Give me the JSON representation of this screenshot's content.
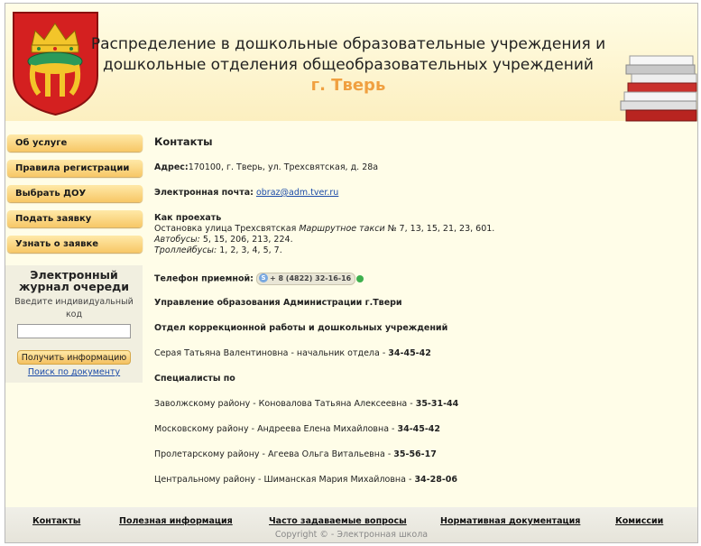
{
  "header": {
    "title_line1": "Распределение в дошкольные образовательные учреждения и",
    "title_line2": "дошкольные отделения общеобразовательных учреждений",
    "city": "г. Тверь"
  },
  "nav": [
    {
      "label": "Об услуге"
    },
    {
      "label": "Правила регистрации"
    },
    {
      "label": "Выбрать ДОУ"
    },
    {
      "label": "Подать заявку"
    },
    {
      "label": "Узнать о заявке"
    }
  ],
  "journal": {
    "title": "Электронный журнал очереди",
    "hint": "Введите индивидуальный код",
    "input_value": "",
    "button_label": "Получить информацию",
    "link_label": "Поиск по документу"
  },
  "content": {
    "heading": "Контакты",
    "address_label": "Адрес:",
    "address_value": "170100, г. Тверь, ул. Трехсвятская, д. 28а",
    "email_label": "Электронная почта:",
    "email_value": "obraz@adm.tver.ru",
    "howto_label": "Как проехать",
    "howto_stop": "Остановка улица Трехсвятская ",
    "howto_taxi_label": "Маршрутное такси",
    "howto_taxi_value": " № 7, 13, 15, 21, 23, 601.",
    "howto_bus_label": "Автобусы:",
    "howto_bus_value": " 5, 15, 206, 213, 224.",
    "howto_trolley_label": "Троллейбусы:",
    "howto_trolley_value": " 1, 2, 3, 4, 5, 7.",
    "phone_label": "Телефон приемной:",
    "phone_value": "+ 8 (4822) 32-16-16",
    "org": "Управление образования Администрации г.Твери",
    "dept": "Отдел коррекционной работы и дошкольных учреждений",
    "head_text": "Серая Татьяна Валентиновна - начальник отдела - ",
    "head_phone": "34-45-42",
    "specialists_label": "Специалисты по",
    "specialists": [
      {
        "text": "Заволжскому району - Коновалова Татьяна Алексеевна - ",
        "phone": "35-31-44"
      },
      {
        "text": "Московскому району - Андреева Елена Михайловна - ",
        "phone": "34-45-42"
      },
      {
        "text": "Пролетарскому району - Агеева Ольга Витальевна - ",
        "phone": "35-56-17"
      },
      {
        "text": "Центральному району - Шиманская Мария Михайловна - ",
        "phone": "34-28-06"
      }
    ]
  },
  "footer": {
    "links": [
      {
        "label": "Контакты"
      },
      {
        "label": "Полезная информация"
      },
      {
        "label": "Часто задаваемые вопросы"
      },
      {
        "label": "Нормативная документация"
      },
      {
        "label": "Комиссии"
      }
    ],
    "copyright": "Copyright © - Электронная школа"
  },
  "colors": {
    "accent": "#f0a040",
    "link": "#1a4aa8",
    "background": "#fffde8"
  }
}
